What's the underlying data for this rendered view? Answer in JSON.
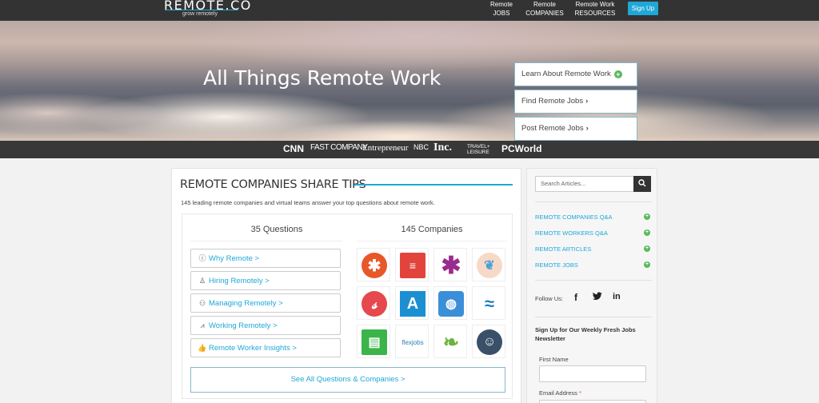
{
  "brand": {
    "logo": "REMOTE.CO",
    "tagline": "grow remotely"
  },
  "nav": {
    "jobs": [
      "Remote",
      "JOBS"
    ],
    "companies": [
      "Remote",
      "COMPANIES"
    ],
    "resources": [
      "Remote Work",
      "RESOURCES"
    ],
    "signup": "Sign Up"
  },
  "hero": {
    "title": "All Things Remote Work",
    "buttons": [
      "Learn About Remote Work",
      "Find Remote Jobs",
      "Post Remote Jobs"
    ]
  },
  "press": {
    "cnn": "CNN",
    "fastcompany": "FAST COMPANY",
    "entrepreneur": "Entrepreneur",
    "nbc": "NBC",
    "inc": "Inc.",
    "travel": [
      "TRAVEL+",
      "LEISURE"
    ],
    "pcworld": "PCWorld"
  },
  "main": {
    "heading": "REMOTE COMPANIES SHARE TIPS",
    "subtitle": "145 leading remote companies and virtual teams answer your top questions about remote work.",
    "questions_title": "35 Questions",
    "companies_title": "145 Companies",
    "questions": [
      "Why Remote >",
      "Hiring Remotely >",
      "Managing Remotely >",
      "Working Remotely >",
      "Remote Worker Insights >"
    ],
    "see_all": "See All Questions & Companies >",
    "company_logo_text": {
      "automattic": "A",
      "flexjobs": "flexjobs"
    }
  },
  "sidebar": {
    "search_placeholder": "Search Articles...",
    "links": [
      "REMOTE COMPANIES Q&A",
      "REMOTE WORKERS Q&A",
      "REMOTE ARTICLES",
      "REMOTE JOBS"
    ],
    "follow_label": "Follow Us:",
    "social": {
      "facebook": "f",
      "twitter": "t",
      "linkedin": "in"
    },
    "newsletter_title": "Sign Up for Our Weekly Fresh Jobs Newsletter",
    "first_name_label": "First Name",
    "email_label": "Email Address",
    "required_marker": "*"
  },
  "colors": {
    "accent": "#1fa8d6",
    "green": "#5cb85c",
    "dark": "#333333"
  }
}
